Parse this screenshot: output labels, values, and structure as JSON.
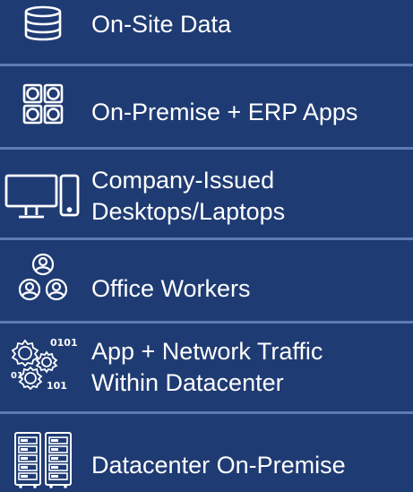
{
  "items": [
    {
      "icon": "database-icon",
      "lines": [
        "On-Site Data"
      ]
    },
    {
      "icon": "apps-grid-icon",
      "lines": [
        "On-Premise + ERP Apps"
      ]
    },
    {
      "icon": "desktop-phone-icon",
      "lines": [
        "Company-Issued",
        "Desktops/Laptops"
      ]
    },
    {
      "icon": "people-icon",
      "lines": [
        "Office Workers"
      ]
    },
    {
      "icon": "gears-binary-icon",
      "lines": [
        "App + Network Traffic",
        "Within Datacenter"
      ]
    },
    {
      "icon": "server-rack-icon",
      "lines": [
        "Datacenter On-Premise"
      ]
    }
  ],
  "colors": {
    "background": "#1f3b73",
    "divider": "#5c7bb3",
    "foreground": "#ffffff"
  }
}
